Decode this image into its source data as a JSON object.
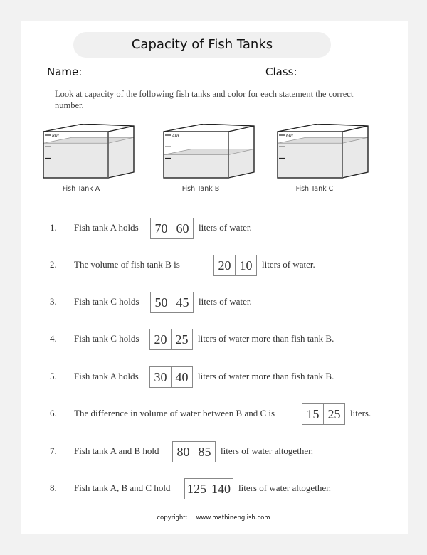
{
  "title": "Capacity of Fish Tanks",
  "name_label": "Name:",
  "class_label": "Class:",
  "instructions": "Look at capacity of the following fish tanks and color for each statement the correct number.",
  "tanks": [
    {
      "label": "Fish Tank A",
      "capacity_mark": "80ℓ",
      "fill_fraction": 0.75
    },
    {
      "label": "Fish Tank B",
      "capacity_mark": "40ℓ",
      "fill_fraction": 0.5
    },
    {
      "label": "Fish Tank C",
      "capacity_mark": "60ℓ",
      "fill_fraction": 0.75
    }
  ],
  "questions": [
    {
      "num": "1.",
      "text": "Fish tank A holds",
      "options": [
        "70",
        "60"
      ],
      "after": "liters of water."
    },
    {
      "num": "2.",
      "text": "The volume of fish tank B is",
      "options": [
        "20",
        "10"
      ],
      "after": "liters of water."
    },
    {
      "num": "3.",
      "text": "Fish tank C holds",
      "options": [
        "50",
        "45"
      ],
      "after": "liters of water."
    },
    {
      "num": "4.",
      "text": "Fish tank C holds",
      "options": [
        "20",
        "25"
      ],
      "after": "liters of water more than fish tank B."
    },
    {
      "num": "5.",
      "text": "Fish tank A holds",
      "options": [
        "30",
        "40"
      ],
      "after": "liters of water more than fish tank B."
    },
    {
      "num": "6.",
      "text": "The difference in volume of water between  B and C is",
      "options": [
        "15",
        "25"
      ],
      "after": "liters."
    },
    {
      "num": "7.",
      "text": "Fish tank A and B hold",
      "options": [
        "80",
        "85"
      ],
      "after": "liters of water altogether."
    },
    {
      "num": "8.",
      "text": "Fish tank A, B and C hold",
      "options": [
        "125",
        "140"
      ],
      "after": "liters of water altogether."
    }
  ],
  "copyright_label": "copyright:",
  "copyright_site": "www.mathinenglish.com"
}
